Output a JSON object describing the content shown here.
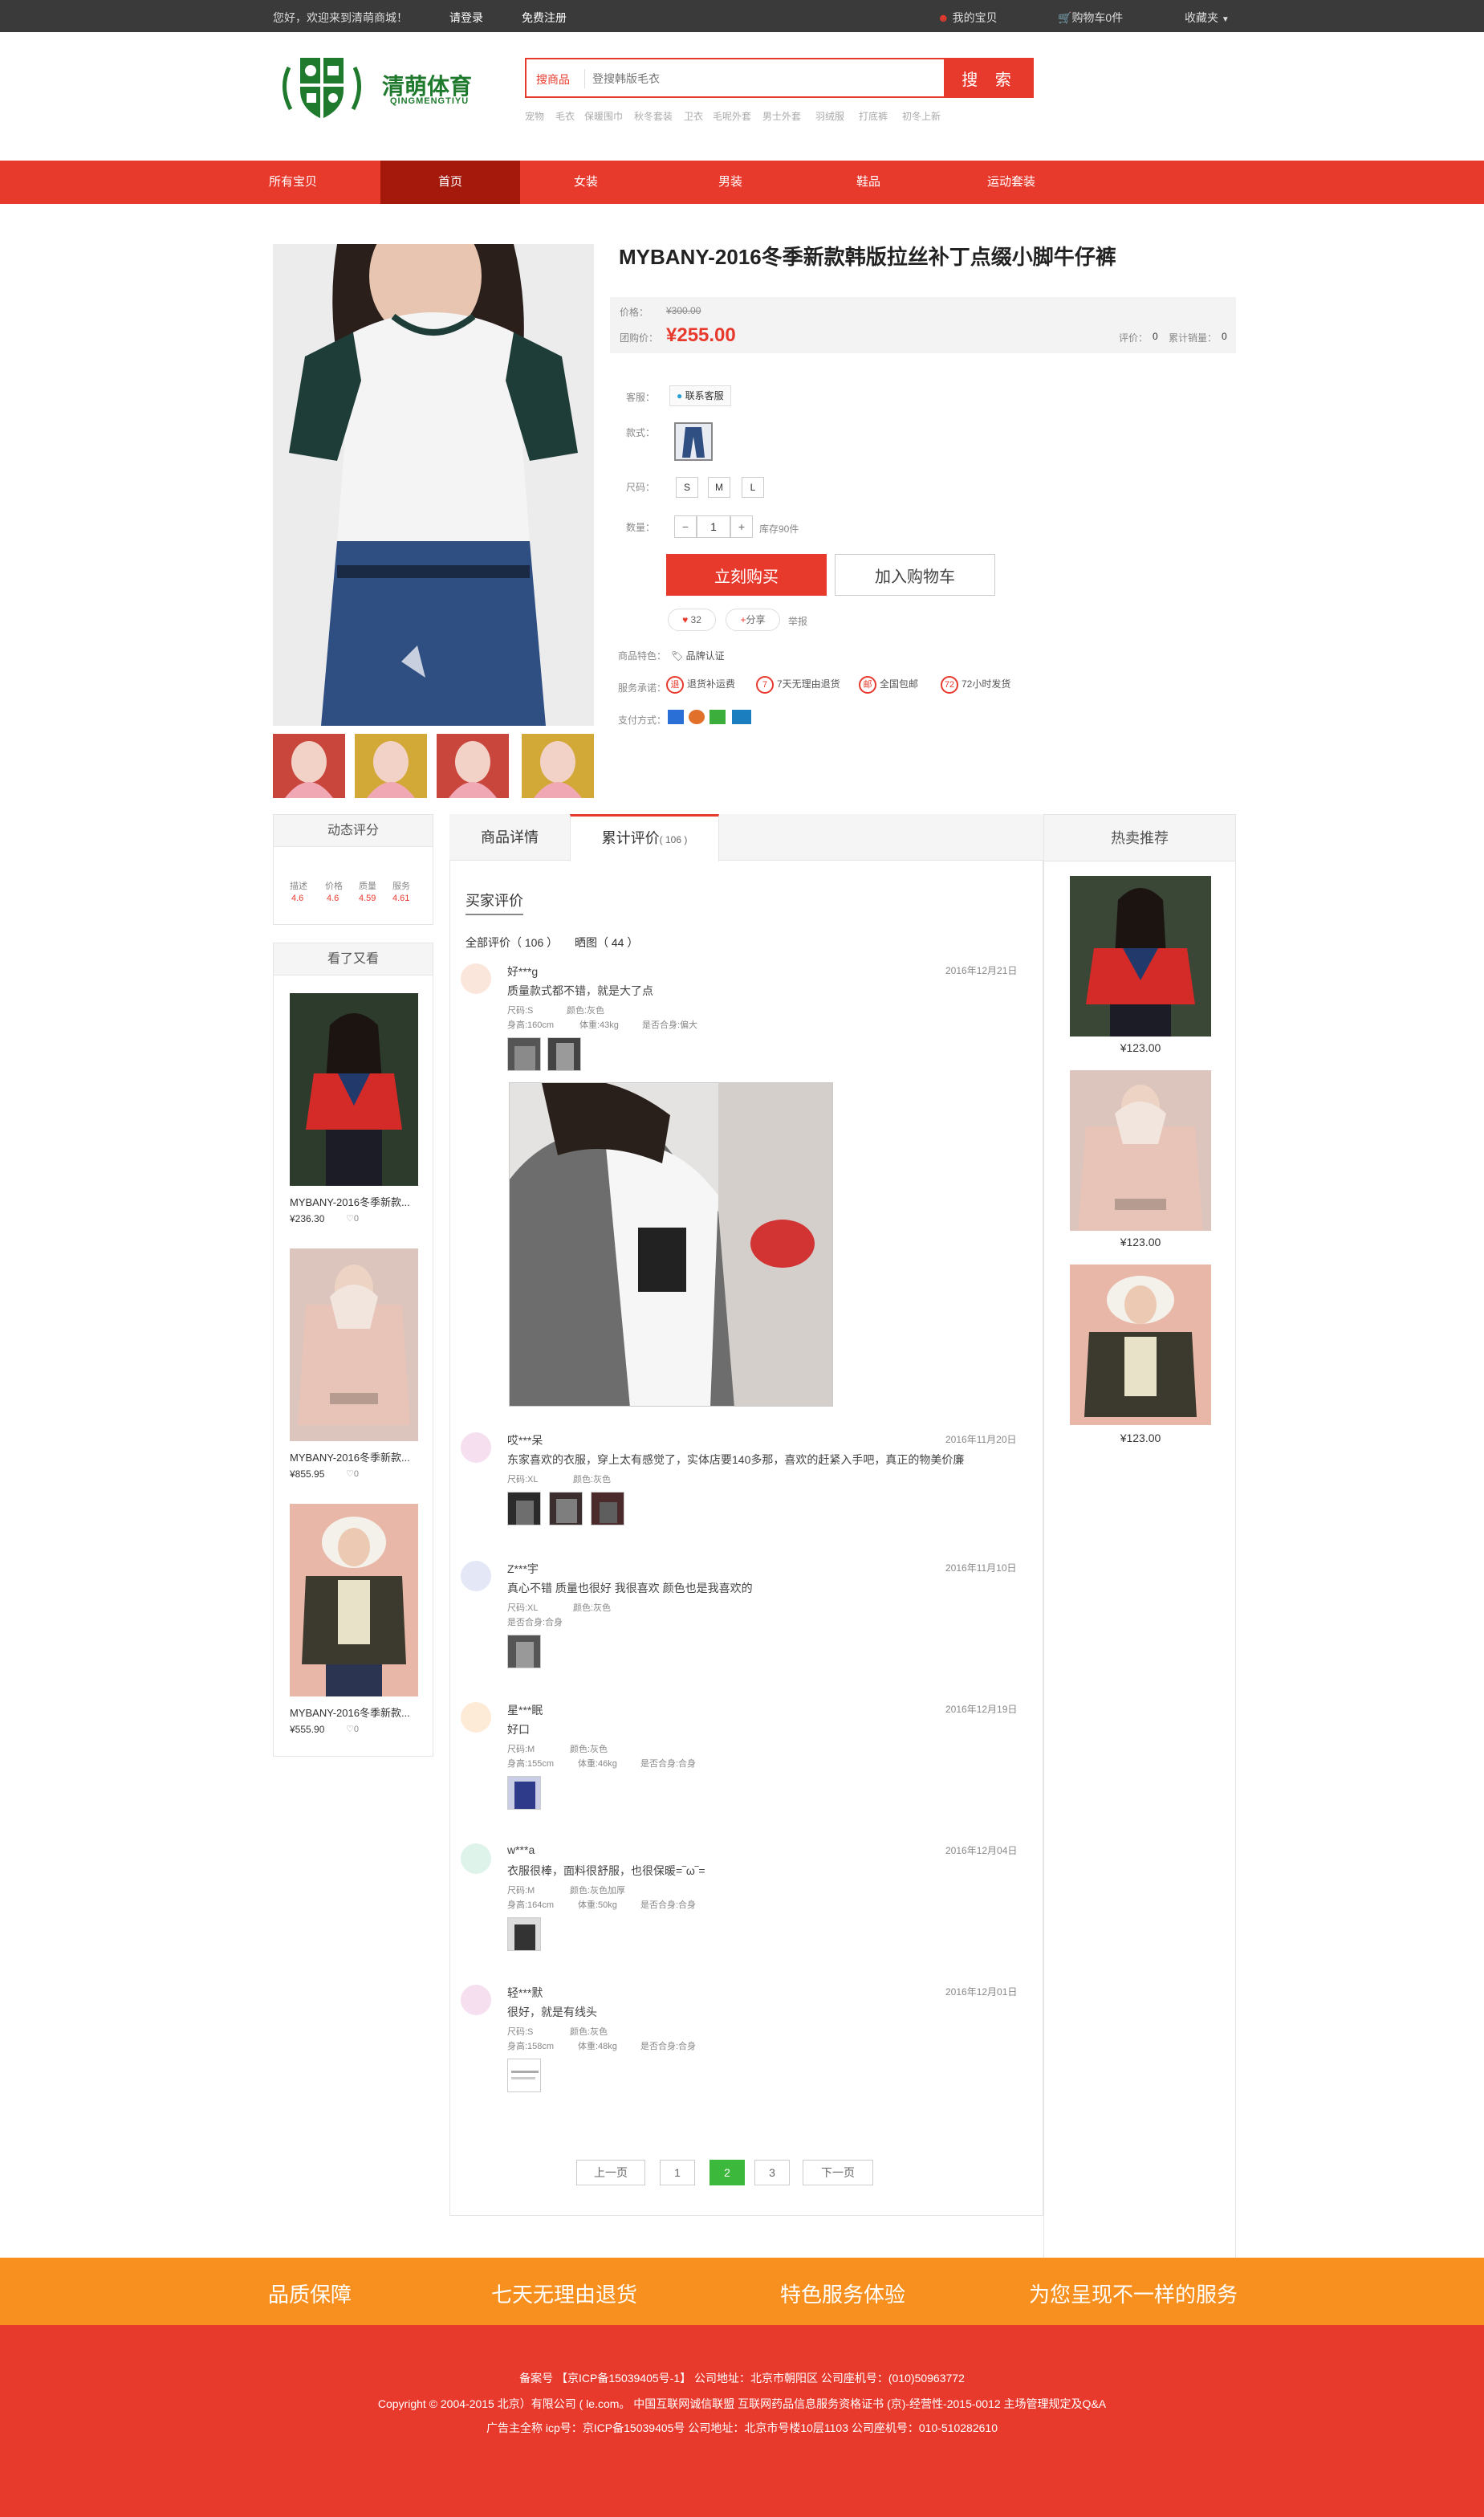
{
  "topbar": {
    "welcome": "您好，欢迎来到清萌商城！",
    "login": "请登录",
    "register": "免费注册",
    "my_items": "我的宝贝",
    "cart": "购物车0件",
    "favorites": "收藏夹"
  },
  "header": {
    "logo_cn": "清萌体育",
    "logo_en": "QINGMENGTIYU",
    "search_category": "搜商品",
    "search_placeholder": "登搜韩版毛衣",
    "search_button": "搜 索",
    "hotwords": [
      "宠物",
      "毛衣",
      "保暖围巾",
      "秋冬套装",
      "卫衣",
      "毛呢外套",
      "男士外套",
      "羽绒服",
      "打底裤",
      "初冬上新"
    ]
  },
  "nav": [
    "所有宝贝",
    "首页",
    "女装",
    "男装",
    "鞋品",
    "运动套装"
  ],
  "product": {
    "title": "MYBANY-2016冬季新款韩版拉丝补丁点缀小脚牛仔裤",
    "price_label": "价格：",
    "orig_price": "¥300.00",
    "promo_label": "团购价：",
    "price": "¥255.00",
    "review_label": "评价：",
    "review_count": "0",
    "sales_label": "累计销量：",
    "sales_count": "0",
    "service_label": "客服：",
    "service_btn": "联系客服",
    "style_label": "款式：",
    "size_label": "尺码：",
    "sizes": [
      "S",
      "M",
      "L"
    ],
    "qty_label": "数量：",
    "qty": "1",
    "stock": "库存90件",
    "buy_now": "立刻购买",
    "add_cart": "加入购物车",
    "like_count": "32",
    "share": "分享",
    "report": "举报",
    "feature_label": "商品特色：",
    "feature": "品牌认证",
    "promise_label": "服务承诺：",
    "promises": [
      "退货补运费",
      "7天无理由退货",
      "全国包邮",
      "72小时发货"
    ],
    "promise_icons": [
      "退",
      "7",
      "邮",
      "72"
    ],
    "pay_label": "支付方式："
  },
  "left": {
    "rating_head": "动态评分",
    "ratings": [
      {
        "k": "描述",
        "v": "4.6"
      },
      {
        "k": "价格",
        "v": "4.6"
      },
      {
        "k": "质量",
        "v": "4.59"
      },
      {
        "k": "服务",
        "v": "4.61"
      }
    ],
    "seen_head": "看了又看",
    "items": [
      {
        "name": "MYBANY-2016冬季新款...",
        "price": "¥236.30",
        "likes": "0"
      },
      {
        "name": "MYBANY-2016冬季新款...",
        "price": "¥855.95",
        "likes": "0"
      },
      {
        "name": "MYBANY-2016冬季新款...",
        "price": "¥555.90",
        "likes": "0"
      }
    ]
  },
  "tabs": {
    "detail": "商品详情",
    "reviews": "累计评价",
    "reviews_count": "( 106 )"
  },
  "reviews": {
    "heading": "买家评价",
    "all": "全部评价（ 106 ）",
    "pics": "晒图（ 44 ）",
    "list": [
      {
        "name": "好***g",
        "date": "2016年12月21日",
        "text": "质量款式都不错，就是大了点",
        "size": "尺码:S",
        "color": "颜色:灰色",
        "height": "身高:160cm",
        "weight": "体重:43kg",
        "fit": "是否合身:偏大"
      },
      {
        "name": "哎***呆",
        "date": "2016年11月20日",
        "text": "东家喜欢的衣服，穿上太有感觉了，实体店要140多那，喜欢的赶紧入手吧，真正的物美价廉",
        "size": "尺码:XL",
        "color": "颜色:灰色",
        "height": "",
        "weight": "",
        "fit": ""
      },
      {
        "name": "Z***宇",
        "date": "2016年11月10日",
        "text": "真心不错 质量也很好 我很喜欢 颜色也是我喜欢的",
        "size": "尺码:XL",
        "color": "颜色:灰色",
        "height": "是否合身:合身",
        "weight": "",
        "fit": ""
      },
      {
        "name": "星***眠",
        "date": "2016年12月19日",
        "text": "好口",
        "size": "尺码:M",
        "color": "颜色:灰色",
        "height": "身高:155cm",
        "weight": "体重:46kg",
        "fit": "是否合身:合身"
      },
      {
        "name": "w***a",
        "date": "2016年12月04日",
        "text": "衣服很棒，面料很舒服，也很保暖=‾ω‾=",
        "size": "尺码:M",
        "color": "颜色:灰色加厚",
        "height": "身高:164cm",
        "weight": "体重:50kg",
        "fit": "是否合身:合身"
      },
      {
        "name": "轻***默",
        "date": "2016年12月01日",
        "text": "很好，就是有线头",
        "size": "尺码:S",
        "color": "颜色:灰色",
        "height": "身高:158cm",
        "weight": "体重:48kg",
        "fit": "是否合身:合身"
      }
    ]
  },
  "pagination": {
    "prev": "上一页",
    "pages": [
      "1",
      "2",
      "3"
    ],
    "next": "下一页"
  },
  "right": {
    "head": "热卖推荐",
    "prices": [
      "¥123.00",
      "¥123.00",
      "¥123.00"
    ]
  },
  "footer": {
    "slogans": [
      "品质保障",
      "七天无理由退货",
      "特色服务体验",
      "为您呈现不一样的服务"
    ],
    "line1": "备案号 【京ICP备15039405号-1】  公司地址：北京市朝阳区 公司座机号：(010)50963772",
    "line2": "Copyright © 2004-2015 北京）有限公司 ( le.com。 中国互联网诚信联盟 互联网药品信息服务资格证书 (京)-经营性-2015-0012      主场管理规定及Q&A",
    "line3": "广告主全称   icp号：京ICP备15039405号   公司地址：北京市号楼10层1103   公司座机号：010-510282610"
  },
  "colors": {
    "accent": "#e8392d",
    "orange": "#f7901e",
    "green": "#1f7a2e",
    "dark": "#3a3a3a"
  }
}
